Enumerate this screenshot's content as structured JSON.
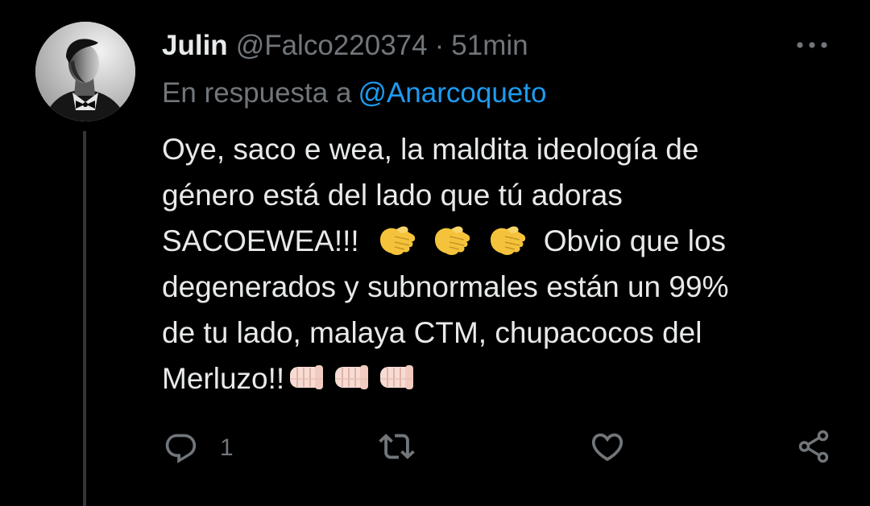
{
  "tweet": {
    "author_name": "Julin",
    "author_handle": "@Falco220374",
    "separator": "·",
    "time": "51min",
    "reply_prefix": "En respuesta a",
    "reply_mention": "@Anarcoqueto",
    "text_lines": [
      "Oye, saco e wea, la maldita ideología de",
      "género está del lado que tú adoras",
      "SACOEWEA!!!",
      "Obvio que los",
      "degenerados y subnormales están un 99%",
      "de tu lado, malaya CTM, chupacocos del",
      "Merluzo!!"
    ],
    "emojis": {
      "line3": [
        "pointing-hand-emoji",
        "pointing-hand-emoji",
        "pointing-hand-emoji"
      ],
      "line7": [
        "fist-bump-emoji",
        "fist-bump-emoji",
        "fist-bump-emoji"
      ]
    }
  },
  "actions": {
    "reply_count": "1",
    "retweet_count": "",
    "like_count": ""
  },
  "colors": {
    "background": "#000000",
    "text": "#e7e9ea",
    "secondary": "#71767b",
    "link": "#1d9bf0",
    "thread_line": "#333639",
    "emoji_yellow": "#f5c33b",
    "emoji_skin_light": "#f7dcd4"
  },
  "icons": [
    "avatar",
    "more-icon",
    "reply-icon",
    "retweet-icon",
    "like-icon",
    "share-icon"
  ]
}
